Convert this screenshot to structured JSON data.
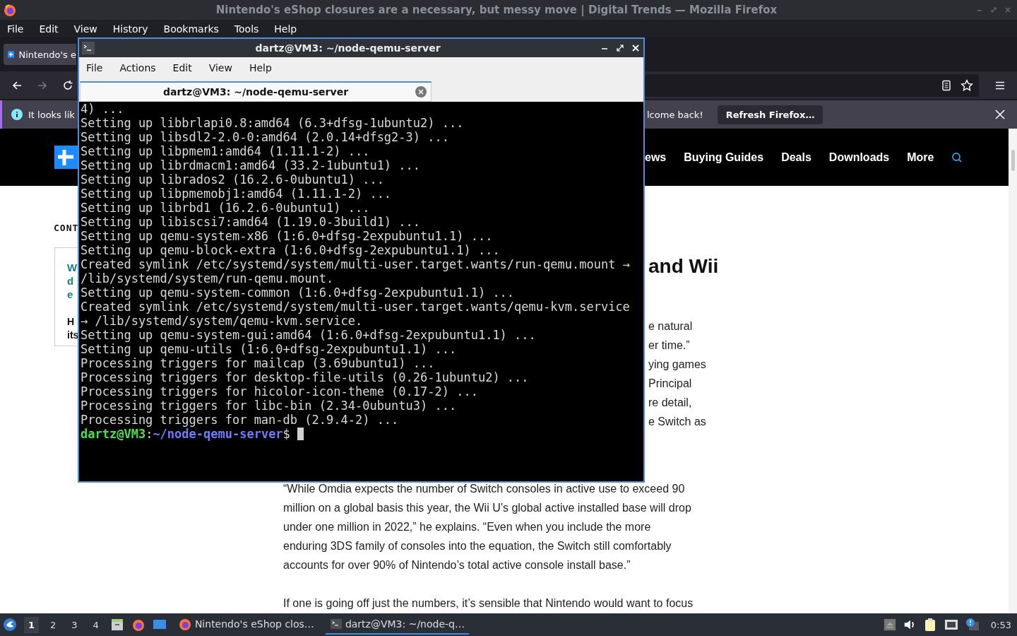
{
  "browser": {
    "title": "Nintendo's eShop closures are a necessary, but messy move | Digital Trends — Mozilla Firefox",
    "menu": [
      "File",
      "Edit",
      "View",
      "History",
      "Bookmarks",
      "Tools",
      "Help"
    ],
    "tab": {
      "title": "Nintendo's e"
    },
    "nav_buttons": [
      {
        "kind": "back",
        "disabled": false
      },
      {
        "kind": "forward",
        "disabled": true
      },
      {
        "kind": "reload",
        "disabled": false
      }
    ],
    "notification": {
      "message": "It looks lik",
      "message_end": "lcome back!",
      "button": "Refresh Firefox…"
    }
  },
  "site": {
    "nav": [
      "ews",
      "Buying Guides",
      "Deals",
      "Downloads",
      "More"
    ]
  },
  "article": {
    "contents_label": "CONT",
    "toc_links": [
      "W",
      "d",
      "e"
    ],
    "toc_text": [
      "H",
      "its"
    ],
    "heading": "and Wii",
    "fragments": [
      "e natural",
      "er time.”",
      "ying games",
      "Principal",
      "re detail,",
      "e Switch as"
    ],
    "paragraphs": [
      [
        "“While Omdia expects the number of Switch consoles in active use to exceed 90",
        "million on a global basis this year, the Wii U’s global active installed base will drop",
        "under one million in 2022,” he explains. “Even when you include the more",
        "enduring 3DS family of consoles into the equation, the Switch still comfortably",
        "accounts for over 90% of Nintendo’s total active console install base.”"
      ],
      [
        "If one is going off just the numbers, it’s sensible that Nintendo would want to focus"
      ]
    ]
  },
  "terminal": {
    "title": "dartz@VM3: ~/node-qemu-server",
    "menu": [
      "File",
      "Actions",
      "Edit",
      "View",
      "Help"
    ],
    "tab": "dartz@VM3: ~/node-qemu-server",
    "lines": [
      "4) ...",
      "Setting up libbrlapi0.8:amd64 (6.3+dfsg-1ubuntu2) ...",
      "Setting up libsdl2-2.0-0:amd64 (2.0.14+dfsg2-3) ...",
      "Setting up libpmem1:amd64 (1.11.1-2) ...",
      "Setting up librdmacm1:amd64 (33.2-1ubuntu1) ...",
      "Setting up librados2 (16.2.6-0ubuntu1) ...",
      "Setting up libpmemobj1:amd64 (1.11.1-2) ...",
      "Setting up librbd1 (16.2.6-0ubuntu1) ...",
      "Setting up libiscsi7:amd64 (1.19.0-3build1) ...",
      "Setting up qemu-system-x86 (1:6.0+dfsg-2expubuntu1.1) ...",
      "Setting up qemu-block-extra (1:6.0+dfsg-2expubuntu1.1) ...",
      "Created symlink /etc/systemd/system/multi-user.target.wants/run-qemu.mount →",
      "/lib/systemd/system/run-qemu.mount.",
      "Setting up qemu-system-common (1:6.0+dfsg-2expubuntu1.1) ...",
      "Created symlink /etc/systemd/system/multi-user.target.wants/qemu-kvm.service",
      "→ /lib/systemd/system/qemu-kvm.service.",
      "Setting up qemu-system-gui:amd64 (1:6.0+dfsg-2expubuntu1.1) ...",
      "Setting up qemu-utils (1:6.0+dfsg-2expubuntu1.1) ...",
      "Processing triggers for mailcap (3.69ubuntu1) ...",
      "Processing triggers for desktop-file-utils (0.26-1ubuntu2) ...",
      "Processing triggers for hicolor-icon-theme (0.17-2) ...",
      "Processing triggers for libc-bin (2.34-0ubuntu3) ...",
      "Processing triggers for man-db (2.9.4-2) ..."
    ],
    "prompt": {
      "user": "dartz@VM3",
      "sep": ":",
      "path": "~/node-qemu-server",
      "symbol": "$"
    }
  },
  "taskbar": {
    "workspaces": [
      {
        "label": "1",
        "selected": true
      },
      {
        "label": "2",
        "selected": false
      },
      {
        "label": "3",
        "selected": false
      },
      {
        "label": "4",
        "selected": false
      }
    ],
    "tasks": [
      {
        "kind": "browser",
        "label": "Nintendo's eShop clos…",
        "selected": false
      },
      {
        "kind": "terminal",
        "label": "dartz@VM3: ~/node-q…",
        "selected": true
      }
    ],
    "clock": "0:53"
  }
}
